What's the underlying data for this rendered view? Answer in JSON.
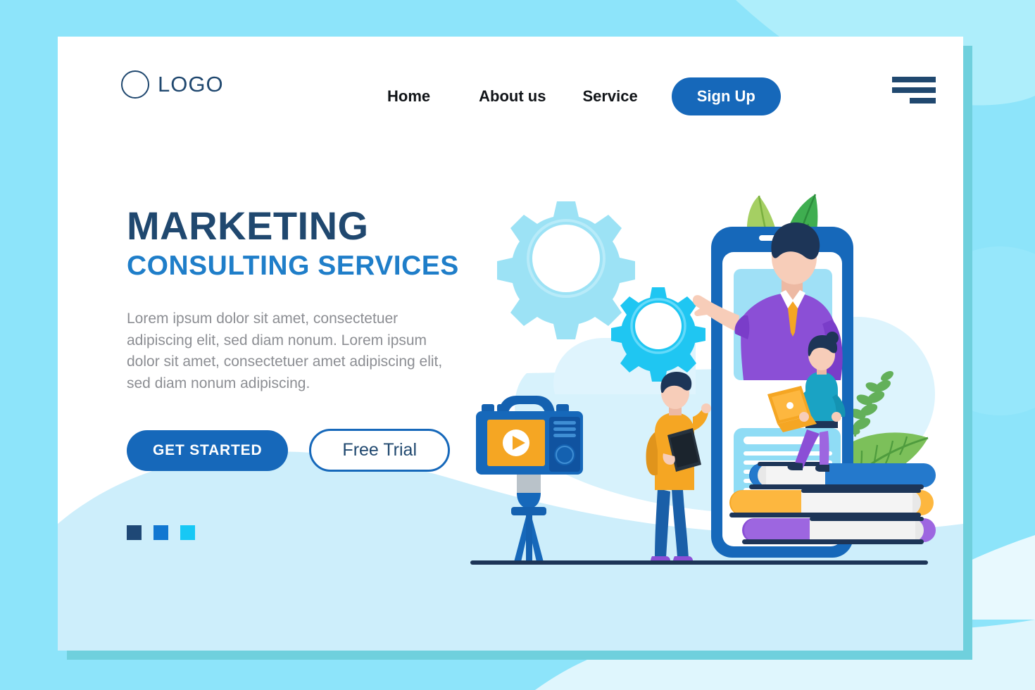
{
  "theme": {
    "page_background": "#8de4fa",
    "card_background": "#ffffff",
    "card_shadow": "#6fd0dd",
    "primary_blue": "#1668ba",
    "navy": "#20486f",
    "link_blue": "#1f7ec9",
    "body_gray": "#8c8e93",
    "wave_cyan": "#cdeefb",
    "accent_cyan": "#17c8f5",
    "accent_orange": "#f5a623",
    "accent_purple": "#8b4fd6",
    "leaf_green": "#4caf50"
  },
  "header": {
    "brand": {
      "label": "LOGO",
      "mark": "circle-outline"
    },
    "nav_items": [
      {
        "id": "home",
        "label": "Home"
      },
      {
        "id": "about",
        "label": "About us"
      },
      {
        "id": "service",
        "label": "Service"
      }
    ],
    "signup_label": "Sign Up",
    "menu_icon": "hamburger-menu-icon"
  },
  "hero": {
    "title": "MARKETING",
    "subtitle": "CONSULTING SERVICES",
    "paragraph": "Lorem ipsum dolor sit amet, consectetuer adipiscing elit, sed diam nonum. Lorem ipsum dolor sit amet, consectetuer amet adipiscing elit, sed diam nonum adipiscing.",
    "primary_cta": "GET STARTED",
    "secondary_cta": "Free Trial",
    "slide_dots": [
      {
        "index": 1,
        "color": "#1f4876",
        "active": true
      },
      {
        "index": 2,
        "color": "#1177d1",
        "active": false
      },
      {
        "index": 3,
        "color": "#17c8f5",
        "active": false
      }
    ]
  },
  "illustration": {
    "name": "marketing-consulting-illustration",
    "elements": [
      {
        "id": "large-gear",
        "name": "gear-icon-large",
        "color": "#9ce2f5"
      },
      {
        "id": "small-gear",
        "name": "gear-icon-small",
        "color": "#1fc6f2"
      },
      {
        "id": "video-camera",
        "name": "video-camera-icon",
        "body_color": "#1668ba",
        "screen_color": "#f5a623",
        "play_button": "play-icon"
      },
      {
        "id": "smartphone",
        "name": "smartphone-frame",
        "frame_color": "#1668ba"
      },
      {
        "id": "presenter",
        "name": "presenter-avatar",
        "suit_color": "#8b4fd6",
        "tie_color": "#f5a623"
      },
      {
        "id": "standing-man",
        "name": "standing-man-avatar",
        "top_color": "#f5a623",
        "pants_color": "#1a5fa8"
      },
      {
        "id": "seated-woman",
        "name": "seated-woman-avatar",
        "top_color": "#1aa3c4",
        "pants_color": "#8b4fd6",
        "laptop_color": "#f5a623"
      },
      {
        "id": "book-stack",
        "name": "book-stack",
        "colors": [
          "#1668ba",
          "#f5a623",
          "#8b4fd6"
        ]
      },
      {
        "id": "leaves-top",
        "name": "leaf-icon-pair",
        "colors": [
          "#a5cf63",
          "#3fae50"
        ]
      },
      {
        "id": "fern-right",
        "name": "fern-plant-icon",
        "color": "#63b05a"
      },
      {
        "id": "content-card",
        "name": "text-placeholder-card",
        "color": "#8fdcf5"
      }
    ]
  }
}
